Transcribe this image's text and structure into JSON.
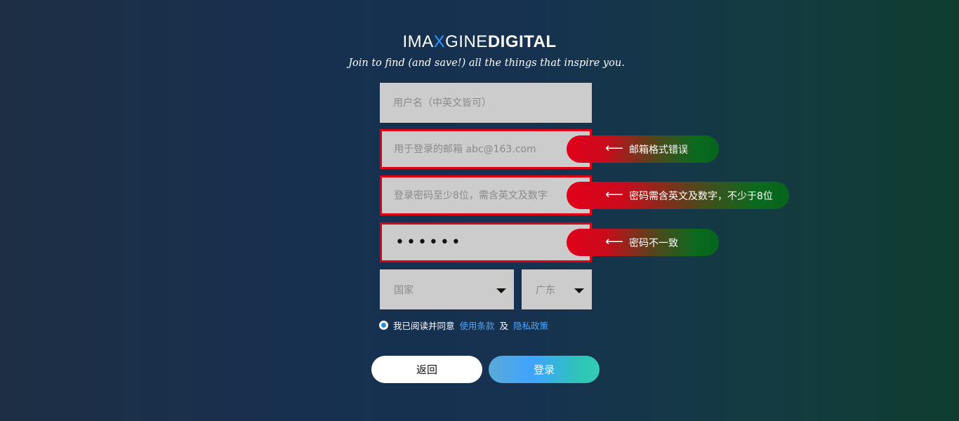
{
  "brand": {
    "part1": "IMA",
    "part2": "X",
    "part3": "GINE",
    "part4": "DIGITAL",
    "tagline": "Join to find (and save!) all the things that inspire you."
  },
  "form": {
    "username": {
      "placeholder": "用户名（中英文皆可）",
      "value": ""
    },
    "email": {
      "placeholder": "用于登录的邮箱 abc@163.com",
      "value": ""
    },
    "password": {
      "placeholder": "登录密码至少8位，需含英文及数字",
      "value": ""
    },
    "confirm_password": {
      "masked_value": "••••••"
    },
    "country": {
      "selected": "国家"
    },
    "province": {
      "selected": "广东"
    }
  },
  "errors": {
    "arrow": "⟵",
    "email": "邮箱格式错误",
    "password": "密码需含英文及数字，不少于8位",
    "confirm_password": "密码不一致"
  },
  "agreement": {
    "prefix": "我已阅读并同意",
    "terms_link": "使用条款",
    "conjunction": "及",
    "privacy_link": "隐私政策"
  },
  "buttons": {
    "back": "返回",
    "login": "登录"
  },
  "colors": {
    "error_border": "#e00014",
    "accent_x": "#2e9bff",
    "link": "#4aa8ff"
  }
}
